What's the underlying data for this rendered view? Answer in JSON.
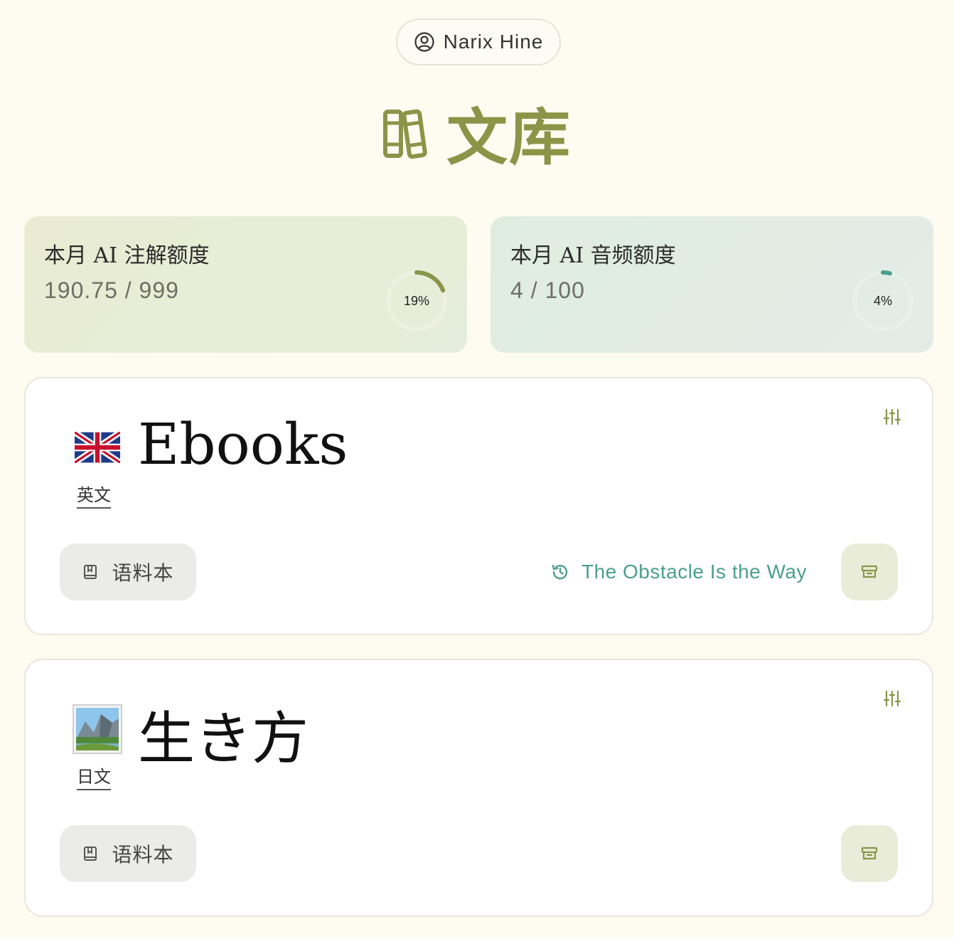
{
  "user": {
    "name": "Narix Hine",
    "icon": "user-circle-icon"
  },
  "header": {
    "title": "文库",
    "icon": "books-icon"
  },
  "quotas": [
    {
      "title": "本月 AI 注解额度",
      "value": "190.75 / 999",
      "percent_label": "19%",
      "fraction": 0.19,
      "color": "#8a9548"
    },
    {
      "title": "本月 AI 音频额度",
      "value": "4 / 100",
      "percent_label": "4%",
      "fraction": 0.04,
      "color": "#4aa08e"
    }
  ],
  "libraries": [
    {
      "name": "Ebooks",
      "language": "英文",
      "icon": "uk-flag-icon",
      "corpus_label": "语料本",
      "recent_book": "The Obstacle Is the Way"
    },
    {
      "name": "生き方",
      "language": "日文",
      "icon": "landscape-photo-icon",
      "corpus_label": "语料本",
      "recent_book": ""
    }
  ],
  "colors": {
    "background": "#fefcf1",
    "accent_olive": "#8a9548",
    "accent_teal": "#4aa08e"
  }
}
